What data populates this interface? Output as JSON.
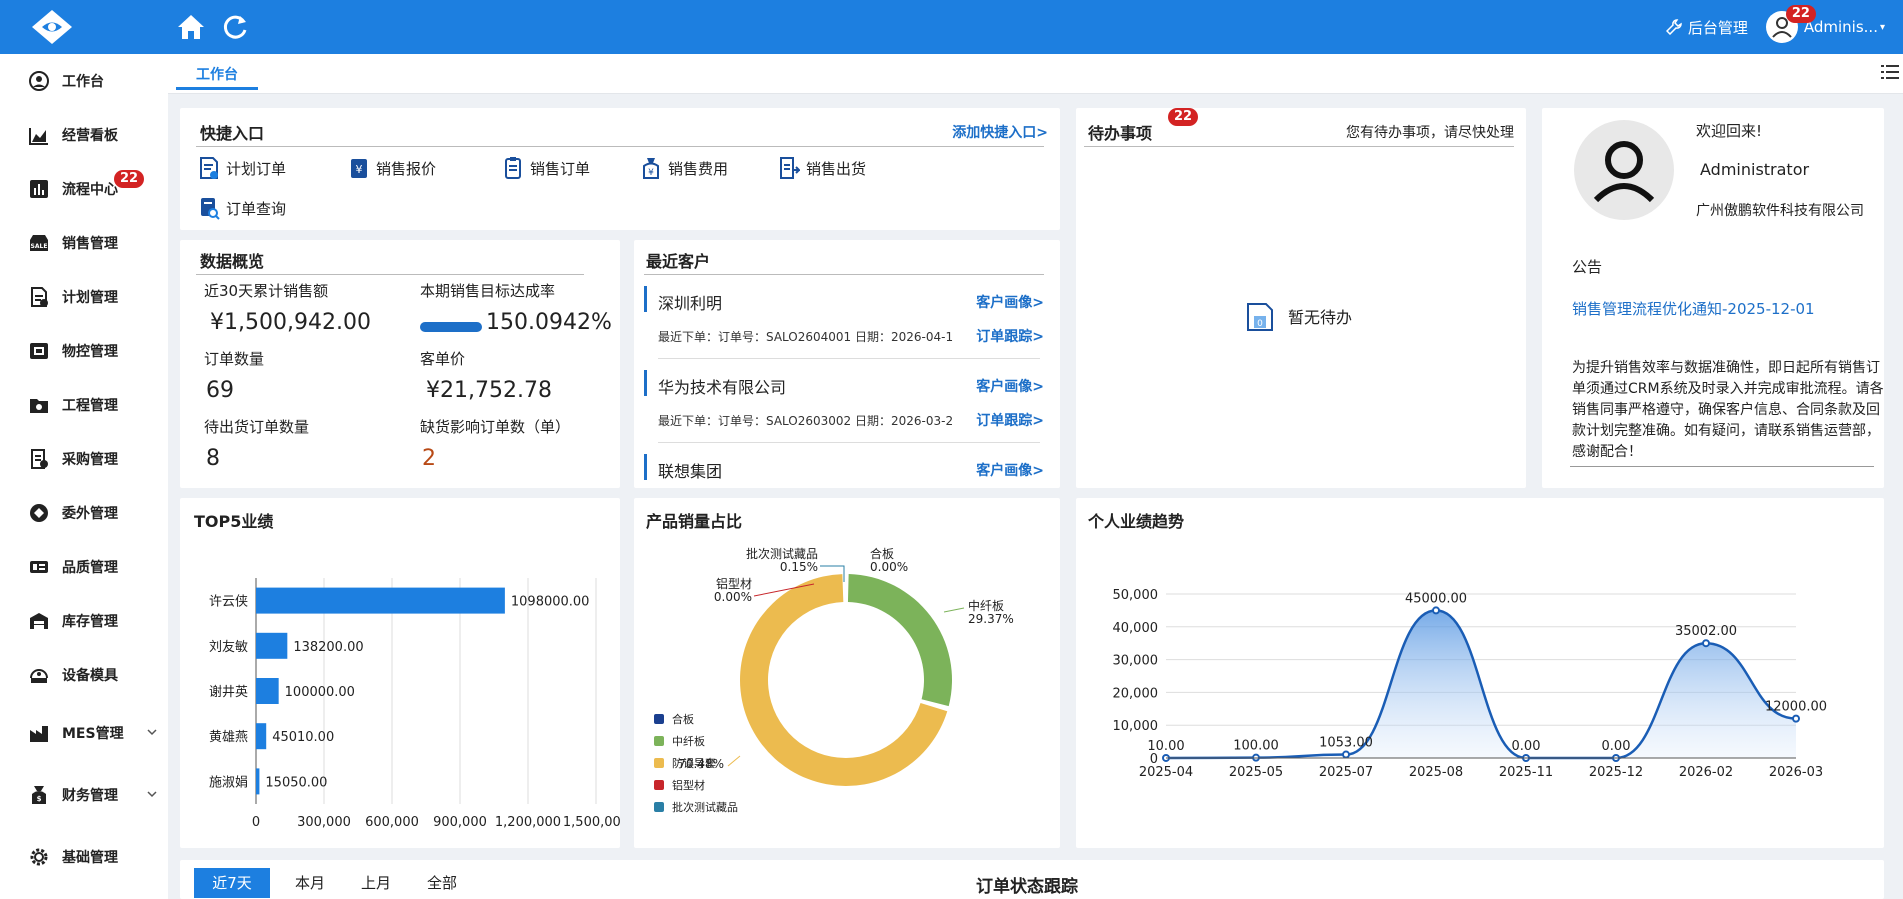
{
  "topbar": {
    "admin_link": "后台管理",
    "user_name": "Adminis...",
    "badge_count": "22"
  },
  "sidebar": {
    "items": [
      {
        "label": "工作台",
        "icon": "user-circle-icon"
      },
      {
        "label": "经营看板",
        "icon": "area-chart-icon"
      },
      {
        "label": "流程中心",
        "icon": "bar-chart-icon",
        "badge": "22"
      },
      {
        "label": "销售管理",
        "icon": "sale-icon"
      },
      {
        "label": "计划管理",
        "icon": "plan-doc-icon"
      },
      {
        "label": "物控管理",
        "icon": "material-icon"
      },
      {
        "label": "工程管理",
        "icon": "folder-gear-icon"
      },
      {
        "label": "采购管理",
        "icon": "purchase-doc-icon"
      },
      {
        "label": "委外管理",
        "icon": "outsource-icon"
      },
      {
        "label": "品质管理",
        "icon": "quality-icon"
      },
      {
        "label": "库存管理",
        "icon": "warehouse-icon"
      },
      {
        "label": "设备模具",
        "icon": "device-icon"
      },
      {
        "label": "MES管理",
        "icon": "factory-icon"
      },
      {
        "label": "财务管理",
        "icon": "wallet-icon"
      },
      {
        "label": "基础管理",
        "icon": "gear-icon"
      }
    ]
  },
  "tabs": {
    "active": "工作台"
  },
  "quick_entry": {
    "title": "快捷入口",
    "add_link": "添加快捷入口>",
    "items": [
      "计划订单",
      "销售报价",
      "销售订单",
      "销售费用",
      "销售出货",
      "订单查询"
    ]
  },
  "todo": {
    "title": "待办事项",
    "badge": "22",
    "hint": "您有待办事项，请尽快处理",
    "empty": "暂无待办"
  },
  "profile": {
    "welcome": "欢迎回来!",
    "name": "Administrator",
    "company": "广州傲鹏软件科技有限公司",
    "notice_label": "公告",
    "notice_title": "销售管理流程优化通知-2025-12-01",
    "notice_body": "为提升销售效率与数据准确性，即日起所有销售订单须通过CRM系统及时录入并完成审批流程。请各销售同事严格遵守，确保客户信息、合同条款及回款计划完整准确。如有疑问，请联系销售运营部，感谢配合！"
  },
  "overview": {
    "title": "数据概览",
    "stats": [
      {
        "label": "近30天累计销售额",
        "value": "¥1,500,942.00"
      },
      {
        "label": "本期销售目标达成率",
        "value": "150.0942%",
        "progress": 1.0
      },
      {
        "label": "订单数量",
        "value": "69"
      },
      {
        "label": "客单价",
        "value": "¥21,752.78"
      },
      {
        "label": "待出货订单数量",
        "value": "8"
      },
      {
        "label": "缺货影响订单数（单）",
        "value": "2"
      }
    ]
  },
  "customers": {
    "title": "最近客户",
    "items": [
      {
        "name": "深圳利明",
        "meta": "最近下单：订单号：SALO2604001   日期：2026-04-1",
        "portrait": "客户画像>",
        "track": "订单跟踪>"
      },
      {
        "name": "华为技术有限公司",
        "meta": "最近下单：订单号：SALO2603002   日期：2026-03-2",
        "portrait": "客户画像>",
        "track": "订单跟踪>"
      },
      {
        "name": "联想集团",
        "portrait": "客户画像>"
      }
    ]
  },
  "top5": {
    "title": "TOP5业绩",
    "chart_data": {
      "type": "bar",
      "orientation": "horizontal",
      "categories": [
        "许云侠",
        "刘友敏",
        "谢井英",
        "黄雄燕",
        "施淑娟"
      ],
      "values": [
        1098000,
        138200,
        100000,
        45010,
        15050
      ],
      "value_labels": [
        "1098000.00",
        "138200.00",
        "100000.00",
        "45010.00",
        "15050.00"
      ],
      "xlim": [
        0,
        1500000
      ],
      "xticks": [
        "0",
        "300,000",
        "600,000",
        "900,000",
        "1,200,000",
        "1,500,000"
      ],
      "grid": true,
      "color": "#1d7fe0"
    }
  },
  "product_share": {
    "title": "产品销量占比",
    "chart_data": {
      "type": "pie",
      "donut": true,
      "slices": [
        {
          "name": "合板",
          "value": 0.0,
          "label": "合板\n0.00%",
          "color": "#1a3f8f"
        },
        {
          "name": "中纤板",
          "value": 29.37,
          "label": "中纤板\n29.37%",
          "color": "#7cb35a"
        },
        {
          "name": "防误导套",
          "value": 70.48,
          "label": "70.48%",
          "color": "#ecbb4f"
        },
        {
          "name": "铝型材",
          "value": 0.0,
          "label": "铝型材\n0.00%",
          "color": "#c7262b"
        },
        {
          "name": "批次测试藏品",
          "value": 0.15,
          "label": "批次测试藏品\n0.15%",
          "color": "#2a7fa6"
        }
      ],
      "legend_position": "bottom-left",
      "legend": [
        "合板",
        "中纤板",
        "防误导套",
        "铝型材",
        "批次测试藏品"
      ],
      "legend_overlap_text": "防误导套"
    }
  },
  "trend": {
    "title": "个人业绩趋势",
    "chart_data": {
      "type": "area",
      "x": [
        "2025-04",
        "2025-05",
        "2025-07",
        "2025-08",
        "2025-11",
        "2025-12",
        "2026-02",
        "2026-03"
      ],
      "y": [
        10,
        100,
        1053,
        45000,
        0,
        0,
        35002,
        12000
      ],
      "labels": [
        "10.00",
        "100.00",
        "1053.00",
        "45000.00",
        "0.00",
        "0.00",
        "35002.00",
        "12000.00"
      ],
      "ylim": [
        0,
        50000
      ],
      "yticks": [
        "0",
        "10,000",
        "20,000",
        "30,000",
        "40,000",
        "50,000"
      ],
      "grid": true,
      "color": "#1a5db5"
    }
  },
  "bottom": {
    "tabs": [
      "近7天",
      "本月",
      "上月",
      "全部"
    ],
    "title": "订单状态跟踪"
  }
}
